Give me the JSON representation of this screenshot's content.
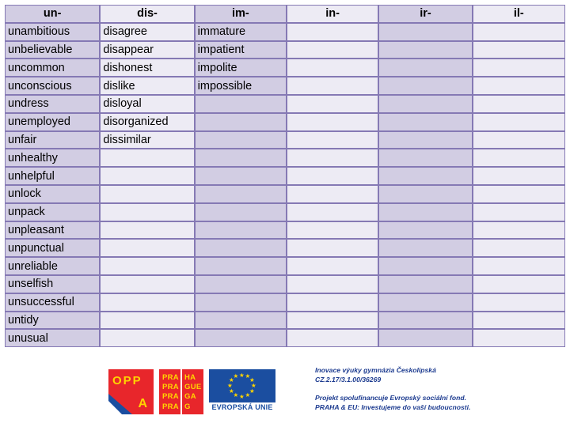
{
  "table": {
    "headers": [
      "un-",
      "dis-",
      "im-",
      "in-",
      "ir-",
      "il-"
    ],
    "columns": [
      [
        "unambitious",
        "unbelievable",
        "uncommon",
        "unconscious",
        "undress",
        "unemployed",
        "unfair",
        "unhealthy",
        "unhelpful",
        "unlock",
        "unpack",
        "unpleasant",
        "unpunctual",
        "unreliable",
        "unselfish",
        "unsuccessful",
        "untidy",
        "unusual"
      ],
      [
        "disagree",
        "disappear",
        "dishonest",
        "dislike",
        "disloyal",
        "disorganized",
        "dissimilar",
        "",
        "",
        "",
        "",
        "",
        "",
        "",
        "",
        "",
        "",
        ""
      ],
      [
        "immature",
        "impatient",
        "impolite",
        "impossible",
        "",
        "",
        "",
        "",
        "",
        "",
        "",
        "",
        "",
        "",
        "",
        "",
        "",
        ""
      ],
      [
        "",
        "",
        "",
        "",
        "",
        "",
        "",
        "",
        "",
        "",
        "",
        "",
        "",
        "",
        "",
        "",
        "",
        ""
      ],
      [
        "",
        "",
        "",
        "",
        "",
        "",
        "",
        "",
        "",
        "",
        "",
        "",
        "",
        "",
        "",
        "",
        "",
        ""
      ],
      [
        "",
        "",
        "",
        "",
        "",
        "",
        "",
        "",
        "",
        "",
        "",
        "",
        "",
        "",
        "",
        "",
        "",
        ""
      ]
    ],
    "row_count": 18,
    "column_count": 6
  },
  "footer": {
    "logos": {
      "oppa": {
        "line": "OPP",
        "letter": "A"
      },
      "praha": {
        "left_lines": [
          "PRA",
          "PRA",
          "PRA",
          "PRA"
        ],
        "right_lines": [
          "HA",
          "GUE",
          "GA",
          "G"
        ]
      },
      "eu": {
        "caption": "EVROPSKÁ UNIE",
        "star_count": 12
      }
    },
    "text": {
      "line1": "Inovace výuky gymnázia Českolipská",
      "line2": "CZ.2.17/3.1.00/36269",
      "line3": "Projekt spolufinancuje Evropský sociální fond.",
      "line4": "PRAHA & EU: Investujeme do vaší budoucnosti."
    }
  },
  "colors": {
    "column_dark": "#d2cde3",
    "column_light": "#edebf4",
    "border": "#8579b4",
    "logo_red": "#e8262b",
    "logo_yellow": "#ffd400",
    "logo_blue": "#1b4ea0",
    "footer_text": "#1b3a8f"
  }
}
